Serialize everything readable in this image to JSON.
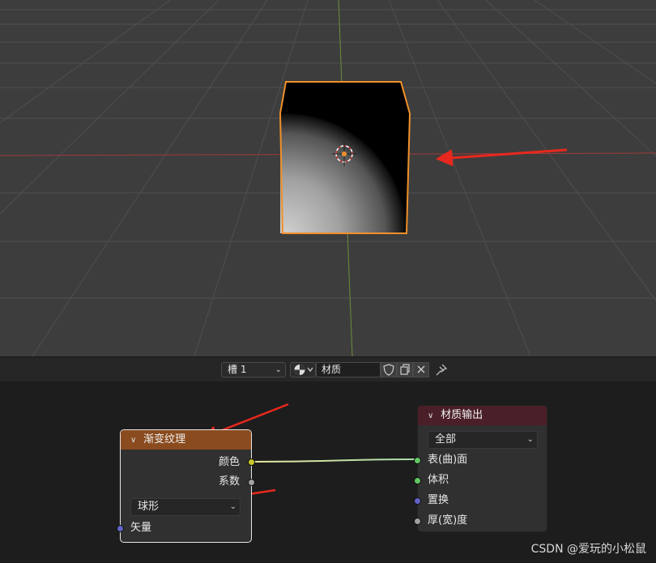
{
  "node_header": {
    "slot_label": "槽 1",
    "material_name": "材质"
  },
  "gradient_node": {
    "title": "渐变纹理",
    "outputs": [
      "颜色",
      "系数"
    ],
    "gradient_type": "球形",
    "inputs": [
      "矢量"
    ],
    "header_color": "#8a4b1e"
  },
  "output_node": {
    "title": "材质输出",
    "target": "全部",
    "inputs": [
      "表(曲)面",
      "体积",
      "置换",
      "厚(宽)度"
    ],
    "header_color": "#4a1f28"
  },
  "colors": {
    "selection_outline": "#f0902a",
    "annotation_arrow": "#e8281e",
    "x_axis": "#a23a3a",
    "y_axis": "#6a8f3a",
    "socket_color": "#c7c729",
    "socket_float": "#a1a1a1",
    "socket_shader": "#63c763",
    "socket_vector": "#6363c7"
  },
  "watermark": "CSDN @爱玩的小松鼠"
}
